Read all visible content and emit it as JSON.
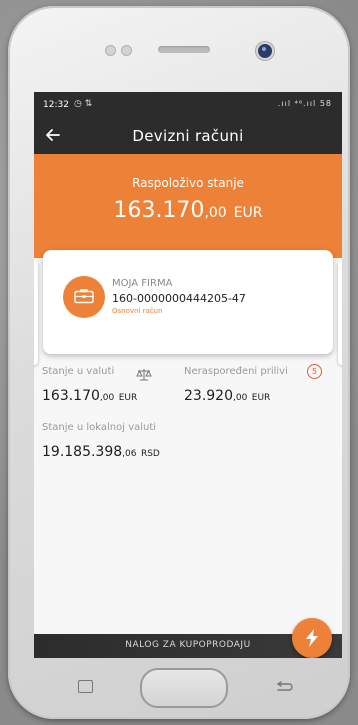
{
  "status_bar": {
    "time": "12:32",
    "left_icons": "◷ ⇅",
    "right_icons": ".ııl  ⁴⁶.ııl  58"
  },
  "toolbar": {
    "title": "Devizni računi"
  },
  "balance": {
    "label": "Raspoloživo stanje",
    "amount_int": "163.170",
    "amount_dec": ",00",
    "currency": "EUR"
  },
  "account_card": {
    "firm_name": "MOJA FIRMA",
    "account_number": "160-0000000444205-47",
    "account_type": "Osnovni račun"
  },
  "details": {
    "currency_balance_label": "Stanje u valuti",
    "currency_balance_int": "163.170",
    "currency_balance_dec": ",00",
    "currency_balance_cur": "EUR",
    "unallocated_label": "Neraspoređeni prilivi",
    "unallocated_count": "5",
    "unallocated_int": "23.920",
    "unallocated_dec": ",00",
    "unallocated_cur": "EUR",
    "local_balance_label": "Stanje u lokalnoj valuti",
    "local_balance_int": "19.185.398",
    "local_balance_dec": ",06",
    "local_balance_cur": "RSD"
  },
  "bottom_bar": {
    "label": "NALOG ZA KUPOPRODAJU"
  },
  "colors": {
    "accent": "#ee8138",
    "dark": "#2c2c2c",
    "badge": "#e2573a"
  }
}
